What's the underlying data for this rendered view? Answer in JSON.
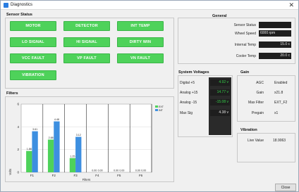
{
  "window": {
    "title": "Diagnostics",
    "close_glyph": "✕"
  },
  "sensor_status": {
    "title": "Sensor Status",
    "buttons": [
      "MOTOR",
      "DETECTOR",
      "INT TEMP",
      "LO SIGNAL",
      "HI SIGNAL",
      "DIRTY WIN",
      "VCC FAULT",
      "VP FAULT",
      "VN FAULT",
      "VIBRATION"
    ],
    "button_color": "#4ed25a"
  },
  "general": {
    "title": "General",
    "rows": [
      {
        "label": "Sensor Status",
        "value": ""
      },
      {
        "label": "Wheel Speed",
        "value": "6000 rpm"
      },
      {
        "label": "Internal Temp",
        "value": "15.0 c"
      },
      {
        "label": "Cooler Temp",
        "value": "20.0 c"
      }
    ]
  },
  "system_voltages": {
    "title": "System Voltages",
    "rows": [
      {
        "label": "Digital +5",
        "value": "4.92 v"
      },
      {
        "label": "Analog +15",
        "value": "14.77 v"
      },
      {
        "label": "Analog -15",
        "value": "-15.08 v"
      },
      {
        "label": "Max Sig",
        "value": "4.38 v"
      }
    ]
  },
  "gain": {
    "title": "Gain",
    "rows": [
      {
        "label": "AGC",
        "value": "Enabled"
      },
      {
        "label": "Gain",
        "value": "x21.8"
      },
      {
        "label": "Max Filter",
        "value": "EXT_F2"
      },
      {
        "label": "Pregain",
        "value": "x1"
      }
    ]
  },
  "vibration": {
    "title": "Vibration",
    "label": "Live Value",
    "value": "18.9063"
  },
  "filters": {
    "title": "Filters",
    "close_label": "Close"
  },
  "chart_data": {
    "type": "bar",
    "categories": [
      "F1",
      "F2",
      "F3",
      "F4",
      "F5",
      "F6"
    ],
    "series": [
      {
        "name": "EXT",
        "values": [
          1.88,
          2.88,
          1.25,
          0.0,
          0.0,
          0.0
        ],
        "color": "#4ed25a"
      },
      {
        "name": "INT",
        "values": [
          3.61,
          4.48,
          3.12,
          0.0,
          0.0,
          0.0
        ],
        "color": "#3d8fe0"
      }
    ],
    "labels": [
      [
        "1.88",
        "2.88",
        "1.25",
        "0.00",
        "0.00",
        "0.00"
      ],
      [
        "3.61",
        "4.48",
        "3.12",
        "0.00",
        "0.00",
        "0.00"
      ]
    ],
    "xlabel": "Filters",
    "ylabel": "Volts",
    "ylim": [
      0,
      6
    ],
    "yticks": [
      "0",
      "2",
      "4",
      "6"
    ],
    "legend_position": "top-right",
    "grid": true
  }
}
